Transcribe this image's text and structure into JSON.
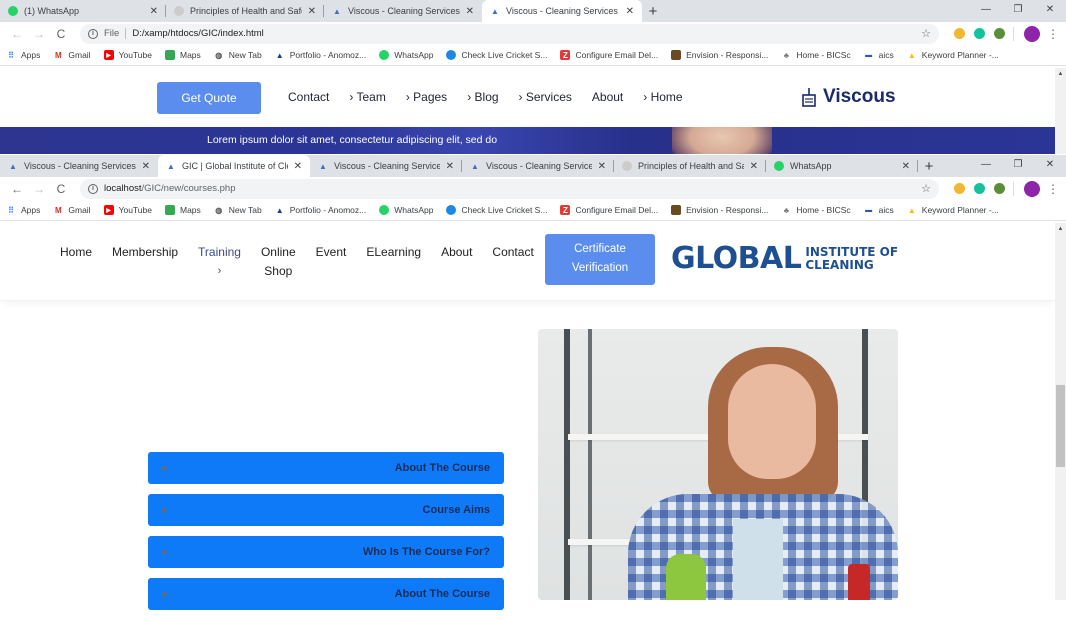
{
  "window1": {
    "tabs": [
      {
        "label": "(1) WhatsApp",
        "icon": "whatsapp-icon",
        "active": false
      },
      {
        "label": "Principles of Health and Safety C",
        "icon": "health-safety-icon",
        "active": false
      },
      {
        "label": "Viscous - Cleaning Services HTM",
        "icon": "viscous-icon",
        "active": false
      },
      {
        "label": "Viscous - Cleaning Services HTM",
        "icon": "viscous-icon",
        "active": true
      }
    ],
    "new_tab": "+",
    "controls": {
      "minimize": "—",
      "restore": "❐",
      "close": "✕"
    },
    "address": {
      "scheme": "File",
      "url": "D:/xamp/htdocs/GIC/index.html"
    }
  },
  "window2": {
    "tabs": [
      {
        "label": "Viscous - Cleaning Services HT",
        "icon": "viscous-icon",
        "active": false
      },
      {
        "label": "GIC | Global Institute of Cleani",
        "icon": "gic-icon",
        "active": true
      },
      {
        "label": "Viscous - Cleaning Services HT",
        "icon": "viscous-icon",
        "active": false
      },
      {
        "label": "Viscous - Cleaning Services HT",
        "icon": "viscous-icon",
        "active": false
      },
      {
        "label": "Principles of Health and Safety",
        "icon": "health-safety-icon",
        "active": false
      },
      {
        "label": "WhatsApp",
        "icon": "whatsapp-icon",
        "active": false
      }
    ],
    "new_tab": "+",
    "controls": {
      "minimize": "—",
      "restore": "❐",
      "close": "✕"
    },
    "address": {
      "host": "localhost",
      "path": "/GIC/new/courses.php"
    }
  },
  "bookmarks": [
    {
      "label": "Apps",
      "icon": "apps-grid-icon"
    },
    {
      "label": "Gmail",
      "icon": "gmail-icon"
    },
    {
      "label": "YouTube",
      "icon": "youtube-icon"
    },
    {
      "label": "Maps",
      "icon": "maps-icon"
    },
    {
      "label": "New Tab",
      "icon": "globe-icon"
    },
    {
      "label": "Portfolio - Anomoz...",
      "icon": "portfolio-icon"
    },
    {
      "label": "WhatsApp",
      "icon": "whatsapp-icon"
    },
    {
      "label": "Check Live Cricket S...",
      "icon": "cricket-icon"
    },
    {
      "label": "Configure Email Del...",
      "icon": "zoho-icon"
    },
    {
      "label": "Envision - Responsi...",
      "icon": "envision-icon"
    },
    {
      "label": "Home - BICSc",
      "icon": "bicsc-icon"
    },
    {
      "label": "aics",
      "icon": "aics-icon"
    },
    {
      "label": "Keyword Planner -...",
      "icon": "google-ads-icon"
    }
  ],
  "viscous_page": {
    "get_quote": "Get Quote",
    "menu": [
      "Contact",
      "› Team",
      "› Pages",
      "› Blog",
      "› Services",
      "About",
      "› Home"
    ],
    "logo": "Viscous",
    "hero_text": "Lorem ipsum dolor sit amet, consectetur adipiscing elit, sed do"
  },
  "gic_page": {
    "menu": [
      {
        "label": "Home",
        "sub": ""
      },
      {
        "label": "Membership",
        "sub": ""
      },
      {
        "label": "Training",
        "sub": "›"
      },
      {
        "label": "Online",
        "sub": "Shop"
      },
      {
        "label": "Event",
        "sub": ""
      },
      {
        "label": "ELearning",
        "sub": ""
      },
      {
        "label": "About",
        "sub": ""
      },
      {
        "label": "Contact",
        "sub": ""
      }
    ],
    "cert_button": {
      "line1": "Certificate",
      "line2": "Verification"
    },
    "logo": {
      "big": "GLOBAL",
      "line1": "INSTITUTE OF",
      "line2": "CLEANING"
    },
    "accordion": [
      "About The Course",
      "Course Aims",
      "Who Is The Course For?",
      "About The Course"
    ],
    "accent_color": "#0f7af8",
    "button_color": "#5b8dee"
  }
}
